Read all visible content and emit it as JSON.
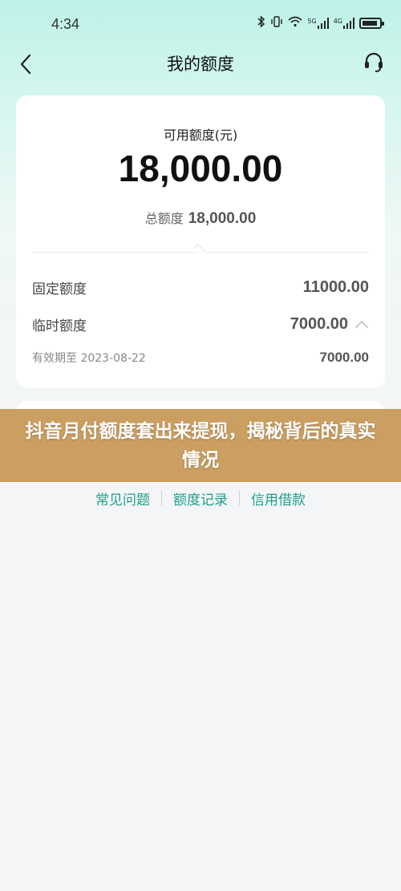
{
  "status_bar": {
    "time": "4:34",
    "net1": "5G",
    "net2": "4G"
  },
  "nav": {
    "title": "我的额度"
  },
  "credit": {
    "available_label": "可用额度(元)",
    "available_amount": "18,000.00",
    "total_label": "总额度",
    "total_amount": "18,000.00",
    "fixed_label": "固定额度",
    "fixed_amount": "11000.00",
    "temp_label": "临时额度",
    "temp_amount": "7000.00",
    "valid_label": "有效期至 2023-08-22",
    "valid_amount": "7000.00"
  },
  "banner": {
    "text": "抖音月付额度套出来提现，揭秘背后的真实情况"
  },
  "footer": {
    "links": [
      "常见问题",
      "额度记录",
      "信用借款"
    ]
  },
  "colors": {
    "accent": "#1e9e8c",
    "banner": "#c99a5a",
    "header_gradient": "#bdf2e8"
  }
}
